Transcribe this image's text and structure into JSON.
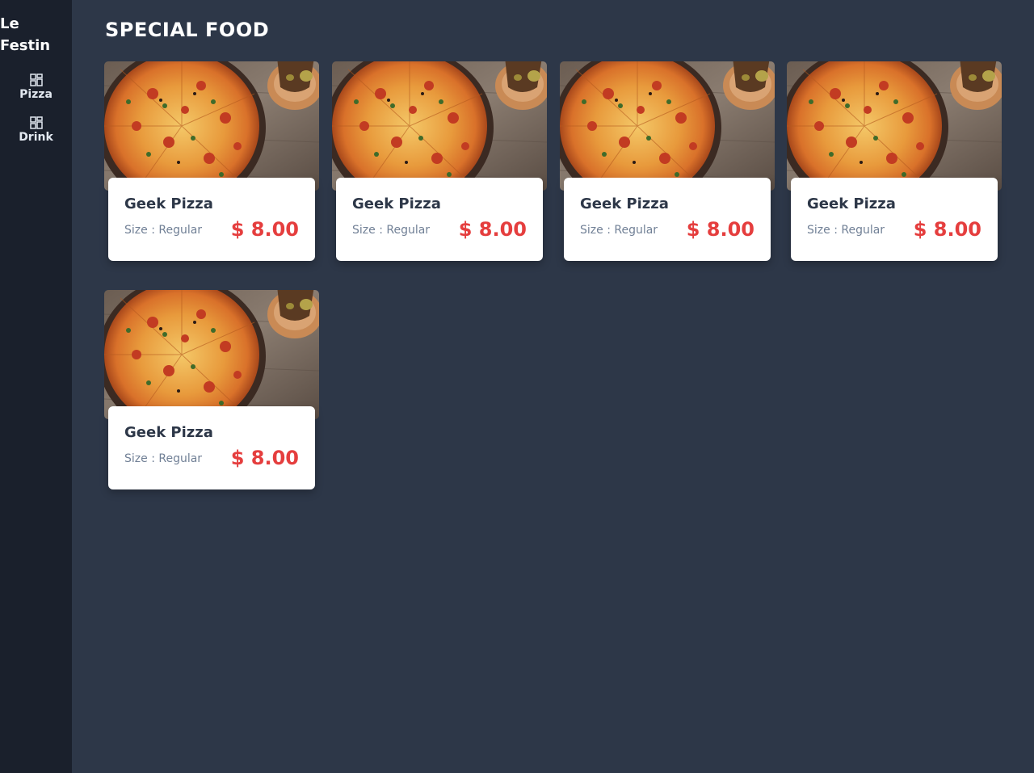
{
  "sidebar": {
    "brand": "Le Festin",
    "items": [
      {
        "label": "Pizza",
        "icon": "grid-icon"
      },
      {
        "label": "Drink",
        "icon": "grid-icon"
      }
    ]
  },
  "main": {
    "title": "SPECIAL FOOD",
    "cards": [
      {
        "name": "Geek Pizza",
        "size": "Size : Regular",
        "price": "$ 8.00",
        "image": "pizza-image"
      },
      {
        "name": "Geek Pizza",
        "size": "Size : Regular",
        "price": "$ 8.00",
        "image": "pizza-image"
      },
      {
        "name": "Geek Pizza",
        "size": "Size : Regular",
        "price": "$ 8.00",
        "image": "pizza-image"
      },
      {
        "name": "Geek Pizza",
        "size": "Size : Regular",
        "price": "$ 8.00",
        "image": "pizza-image"
      },
      {
        "name": "Geek Pizza",
        "size": "Size : Regular",
        "price": "$ 8.00",
        "image": "pizza-image"
      }
    ]
  },
  "colors": {
    "background": "#2d3748",
    "sidebar": "#1a202c",
    "price": "#e53e3e",
    "card": "#ffffff"
  }
}
